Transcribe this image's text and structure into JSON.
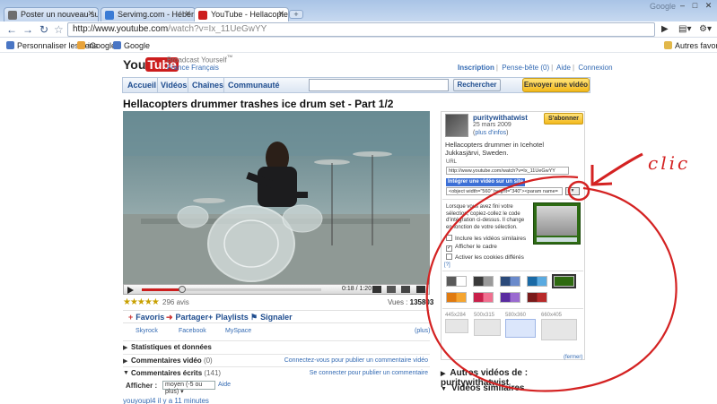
{
  "browser": {
    "tabs": [
      {
        "title": "Poster un nouveau sujet",
        "color": "#6e6e6e"
      },
      {
        "title": "Servimg.com - Hébergeu...",
        "color": "#3a7bd5"
      },
      {
        "title": "YouTube - Hellacopters ...",
        "color": "#cc1d1d"
      }
    ],
    "new_tab": "+",
    "brand": "Google",
    "url_host": "http://www.youtube.com",
    "url_path": "/watch?v=Ix_11UeGwYY",
    "bookmarks": [
      {
        "label": "Personnaliser les liens",
        "color": "#4a76c4"
      },
      {
        "label": "iGoogle",
        "color": "#e8a33a"
      },
      {
        "label": "Google",
        "color": "#4a76c4"
      }
    ],
    "other_bookmarks": "Autres favoris"
  },
  "header": {
    "logo_you": "You",
    "logo_tube": "Tube",
    "tagline": "Broadcast Yourself",
    "tm": "™",
    "locale": [
      "France",
      "Français"
    ],
    "toplinks": [
      "Inscription",
      "Pense-bête (0)",
      "Aide",
      "Connexion"
    ]
  },
  "nav": {
    "items": [
      "Accueil",
      "Vidéos",
      "Chaînes",
      "Communauté"
    ],
    "search_button": "Rechercher",
    "upload_button": "Envoyer une vidéo"
  },
  "video": {
    "title": "Hellacopters drummer trashes ice drum set - Part 1/2",
    "time": "0:18 / 1:20",
    "progress": 0.225,
    "stars": "★★★★★",
    "reviews": "296 avis",
    "views_label": "Vues :",
    "views": "135803"
  },
  "actions": [
    "Favoris",
    "Partager",
    "Playlists",
    "Signaler"
  ],
  "share_links": [
    "Skyrock",
    "Facebook",
    "MySpace",
    "(plus)"
  ],
  "sections": [
    {
      "label": "Statistiques et données",
      "count": "",
      "link": ""
    },
    {
      "label": "Commentaires vidéo",
      "count": "(0)",
      "link": "Connectez-vous pour publier un commentaire vidéo"
    },
    {
      "label": "Commentaires écrits",
      "count": "(141)",
      "link": "Se connecter pour publier un commentaire"
    }
  ],
  "comments": {
    "show_label": "Afficher :",
    "show_value": "moyen (-5 ou plus)",
    "help": "Aide",
    "next_row": "youyoupl4 il y a 11 minutes"
  },
  "sidebar": {
    "uploader": "puritywithatwist",
    "date": "25 mars 2009",
    "more_info": "plus d'infos",
    "subscribe": "S'abonner",
    "description": "Hellacopters drummer in Icehotel Jukkasjärvi, Sweden.",
    "url_label": "URL",
    "url_value": "http://www.youtube.com/watch?v=Ix_11UeGwYY",
    "embed_label": "Intégrer une vidéo sur un site",
    "embed_value": "<object width=\"560\" height=\"340\"><param name=",
    "embed_opts": "▼",
    "custom_text": "Lorsque vous avez fini votre sélection, copiez-collez le code d'intégration ci-dessus. Il change en fonction de votre sélection.",
    "options": [
      {
        "label": "Inclure les vidéos similaires",
        "checked": false
      },
      {
        "label": "Afficher le cadre",
        "checked": true
      },
      {
        "label": "Activer les cookies différés",
        "checked": false
      }
    ],
    "help": "[?]",
    "swatches": [
      [
        "#5a5a5a",
        "#ffffff"
      ],
      [
        "#3a3a3a",
        "#9a9a9a"
      ],
      [
        "#2b4a7a",
        "#6a8acb"
      ],
      [
        "#1a6aa6",
        "#5aaae0"
      ],
      [
        "#2e6a10",
        "#2e6a10"
      ],
      [
        "#e07a10",
        "#f5a530"
      ],
      [
        "#c8204a",
        "#f07090"
      ],
      [
        "#5a2ca0",
        "#9a6ad0"
      ],
      [
        "#7a1a1a",
        "#b82a2a"
      ]
    ],
    "sizes": [
      "445x284",
      "500x315",
      "580x360",
      "660x405"
    ],
    "selected_size": 2,
    "close": "(fermer)",
    "more_from": "Autres vidéos de : puritywithatwist",
    "related": "Vidéos similaires"
  },
  "annotation": {
    "text": "clic",
    "color": "#d42222"
  }
}
